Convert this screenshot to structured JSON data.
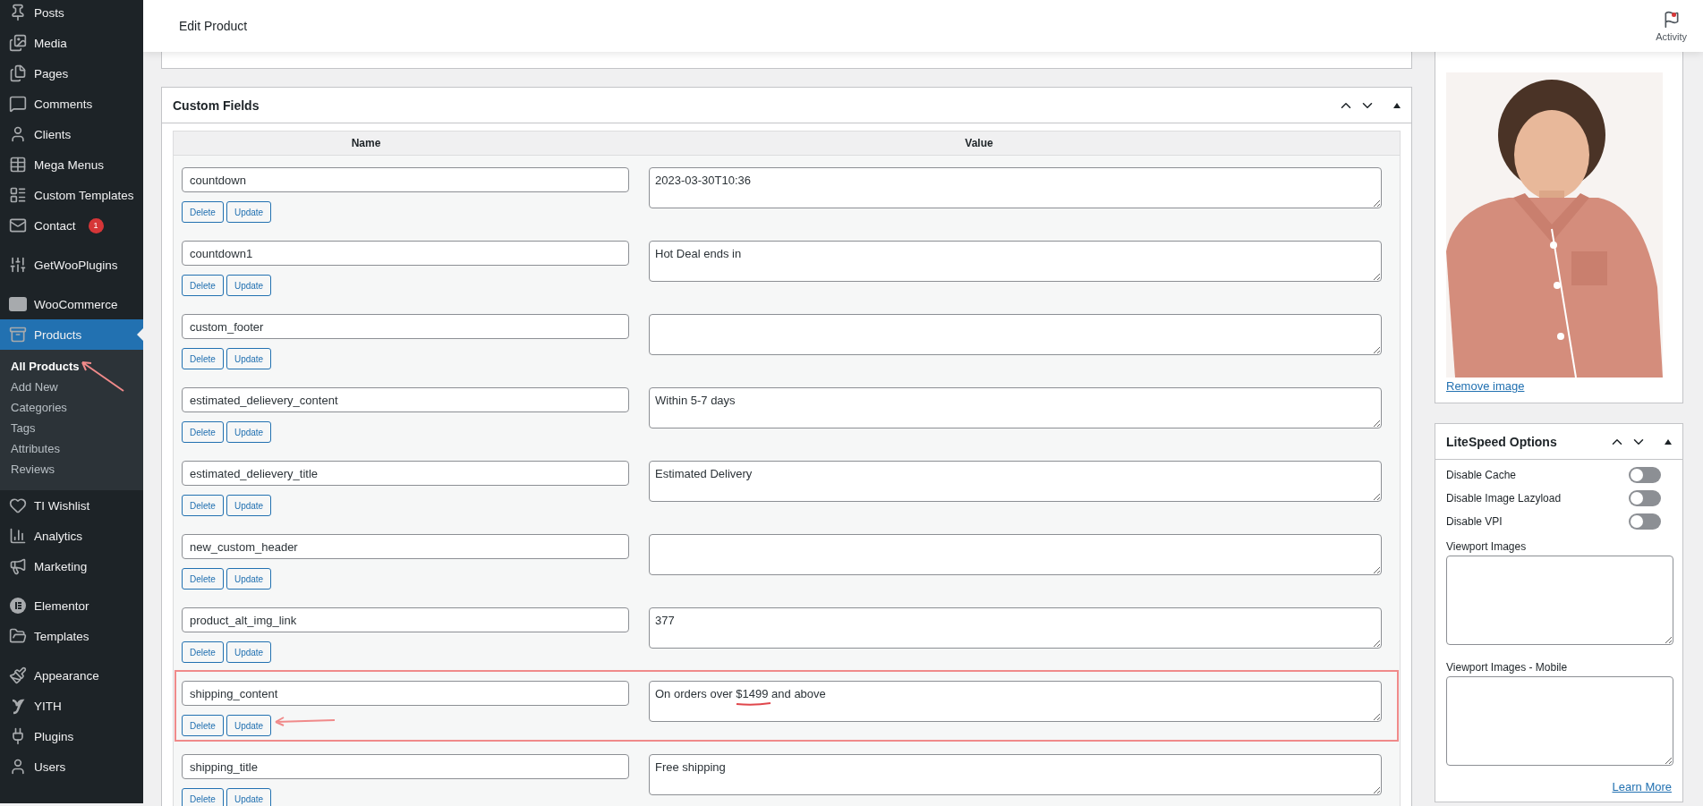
{
  "sidebar": {
    "groups": [
      [
        {
          "label": "Posts",
          "selected": false
        },
        {
          "label": "Media",
          "selected": false
        },
        {
          "label": "Pages",
          "selected": false
        },
        {
          "label": "Comments",
          "selected": false
        },
        {
          "label": "Clients",
          "selected": false
        },
        {
          "label": "Mega Menus",
          "selected": false
        },
        {
          "label": "Custom Templates",
          "selected": false
        },
        {
          "label": "Contact",
          "selected": false,
          "badge": "1"
        }
      ],
      [
        {
          "label": "GetWooPlugins",
          "selected": false
        }
      ],
      [
        {
          "label": "WooCommerce",
          "selected": false
        },
        {
          "label": "Products",
          "selected": true,
          "submenu": [
            {
              "label": "All Products",
              "selected": true
            },
            {
              "label": "Add New",
              "selected": false
            },
            {
              "label": "Categories",
              "selected": false
            },
            {
              "label": "Tags",
              "selected": false
            },
            {
              "label": "Attributes",
              "selected": false
            },
            {
              "label": "Reviews",
              "selected": false
            }
          ]
        },
        {
          "label": "TI Wishlist",
          "selected": false
        },
        {
          "label": "Analytics",
          "selected": false
        },
        {
          "label": "Marketing",
          "selected": false
        }
      ],
      [
        {
          "label": "Elementor",
          "selected": false
        },
        {
          "label": "Templates",
          "selected": false
        }
      ],
      [
        {
          "label": "Appearance",
          "selected": false
        },
        {
          "label": "YITH",
          "selected": false
        },
        {
          "label": "Plugins",
          "selected": false
        },
        {
          "label": "Users",
          "selected": false
        }
      ]
    ]
  },
  "header": {
    "title": "Edit Product",
    "activity": "Activity"
  },
  "custom_fields": {
    "title": "Custom Fields",
    "columns": [
      "Name",
      "Value"
    ],
    "rows": [
      {
        "name": "countdown",
        "value": "2023-03-30T10:36",
        "highlighted": false,
        "delete_label": "Delete",
        "update_label": "Update"
      },
      {
        "name": "countdown1",
        "value": "Hot Deal ends in",
        "highlighted": false,
        "delete_label": "Delete",
        "update_label": "Update"
      },
      {
        "name": "custom_footer",
        "highlighted": false,
        "delete_label": "Delete",
        "update_label": "Update"
      },
      {
        "name": "estimated_delievery_content",
        "value": "Within 5-7 days",
        "highlighted": false,
        "delete_label": "Delete",
        "update_label": "Update"
      },
      {
        "name": "estimated_delievery_title",
        "value": "Estimated Delivery",
        "highlighted": false,
        "delete_label": "Delete",
        "update_label": "Update"
      },
      {
        "name": "new_custom_header",
        "highlighted": false,
        "delete_label": "Delete",
        "update_label": "Update"
      },
      {
        "name": "product_alt_img_link",
        "value": "377",
        "highlighted": false,
        "delete_label": "Delete",
        "update_label": "Update"
      },
      {
        "name": "shipping_content",
        "value": "On orders over $1499 and above",
        "highlighted": true,
        "delete_label": "Delete",
        "update_label": "Update"
      },
      {
        "name": "shipping_title",
        "value": "Free shipping",
        "highlighted": false,
        "delete_label": "Delete",
        "update_label": "Update"
      }
    ]
  },
  "hover_image": {
    "remove_link": "Remove image"
  },
  "litespeed": {
    "title": "LiteSpeed Options",
    "toggles": [
      {
        "label": "Disable Cache",
        "on": false
      },
      {
        "label": "Disable Image Lazyload",
        "on": false
      },
      {
        "label": "Disable VPI",
        "on": false
      }
    ],
    "fields": [
      {
        "label": "Viewport Images"
      },
      {
        "label": "Viewport Images - Mobile"
      }
    ],
    "learn_more": "Learn More"
  }
}
